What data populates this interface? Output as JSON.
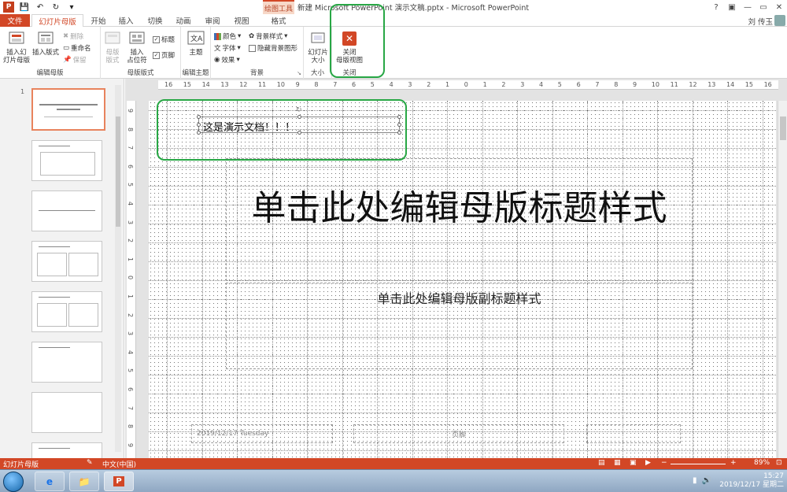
{
  "titlebar": {
    "drawing_tools": "绘图工具",
    "window_title": "新建 Microsoft PowerPoint 演示文稿.pptx - Microsoft PowerPoint",
    "help": "?",
    "restore": "▣",
    "minimize": "—",
    "maximize": "▭",
    "close": "✕"
  },
  "tabs": {
    "file": "文件",
    "slide_master": "幻灯片母版",
    "home": "开始",
    "insert": "插入",
    "transitions": "切换",
    "animations": "动画",
    "review": "审阅",
    "view": "视图",
    "format": "格式",
    "user": "刘 传玉"
  },
  "ribbon": {
    "insert_master": "插入幻\n灯片母版",
    "insert_layout": "插入版式",
    "delete": "删除",
    "rename": "重命名",
    "preserve": "保留",
    "group_edit_master": "编辑母版",
    "master_layout": "母版\n版式",
    "insert_placeholder": "插入\n占位符",
    "title_check": "标题",
    "footer_check": "页脚",
    "group_master_layout": "母版版式",
    "themes": "主题",
    "group_edit_theme": "编辑主题",
    "colors": "颜色",
    "fonts": "字体",
    "effects": "效果",
    "bg_styles": "背景样式",
    "hide_bg": "隐藏背景图形",
    "group_background": "背景",
    "slide_size": "幻灯片\n大小",
    "group_size": "大小",
    "close_master": "关闭\n母版视图",
    "group_close": "关闭"
  },
  "ruler": {
    "h_ticks": [
      "16",
      "15",
      "14",
      "13",
      "12",
      "11",
      "10",
      "9",
      "8",
      "7",
      "6",
      "5",
      "4",
      "3",
      "2",
      "1",
      "0",
      "1",
      "2",
      "3",
      "4",
      "5",
      "6",
      "7",
      "8",
      "9",
      "10",
      "11",
      "12",
      "13",
      "14",
      "15",
      "16"
    ],
    "v_ticks": [
      "9",
      "8",
      "7",
      "6",
      "5",
      "4",
      "3",
      "2",
      "1",
      "0",
      "1",
      "2",
      "3",
      "4",
      "5",
      "6",
      "7",
      "8",
      "9"
    ]
  },
  "slide": {
    "textbox": "这是演示文档！！！",
    "title": "单击此处编辑母版标题样式",
    "subtitle": "单击此处编辑母版副标题样式",
    "date": "2019/12/17 Tuesday",
    "footer": "页脚"
  },
  "status": {
    "mode": "幻灯片母版",
    "lang": "中文(中国)",
    "zoom": "89%"
  },
  "taskbar": {
    "time": "15:27",
    "date": "2019/12/17 星期二"
  },
  "colors": {
    "accent": "#d24726",
    "highlight": "#28a745"
  }
}
